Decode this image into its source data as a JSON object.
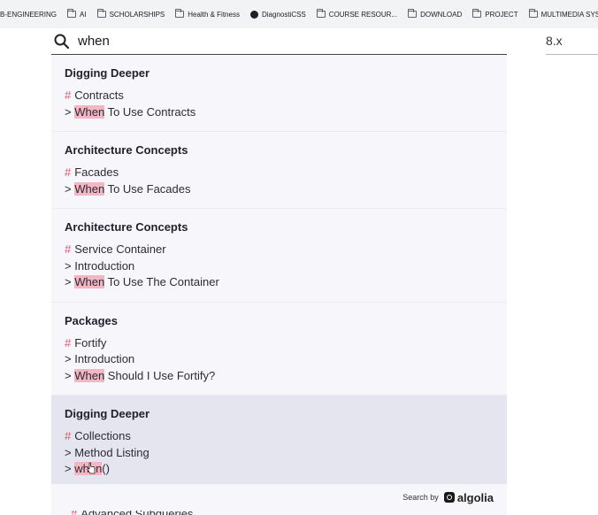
{
  "bookmarks": [
    {
      "label": "B-ENGINEERING",
      "icon": "none"
    },
    {
      "label": "AI",
      "icon": "folder-icon"
    },
    {
      "label": "SCHOLARSHIPS",
      "icon": "folder-icon"
    },
    {
      "label": "Health & Fitness",
      "icon": "folder-icon"
    },
    {
      "label": "DiagnostiCSS",
      "icon": "globe-icon"
    },
    {
      "label": "COURSE RESOUR...",
      "icon": "folder-icon"
    },
    {
      "label": "DOWNLOAD",
      "icon": "folder-icon"
    },
    {
      "label": "PROJECT",
      "icon": "folder-icon"
    },
    {
      "label": "MULTIMEDIA SYS...",
      "icon": "folder-icon"
    }
  ],
  "search": {
    "value": "when",
    "version": "8.x"
  },
  "results": [
    {
      "title": "Digging Deeper",
      "lines": [
        {
          "type": "hash",
          "pre": "",
          "hl": "",
          "post": "Contracts"
        },
        {
          "type": "arrow",
          "pre": "",
          "hl": "When",
          "post": " To Use Contracts"
        }
      ]
    },
    {
      "title": "Architecture Concepts",
      "lines": [
        {
          "type": "hash",
          "pre": "",
          "hl": "",
          "post": "Facades"
        },
        {
          "type": "arrow",
          "pre": "",
          "hl": "When",
          "post": " To Use Facades"
        }
      ]
    },
    {
      "title": "Architecture Concepts",
      "lines": [
        {
          "type": "hash",
          "pre": "",
          "hl": "",
          "post": "Service Container"
        },
        {
          "type": "arrow",
          "pre": "",
          "hl": "",
          "post": "Introduction"
        },
        {
          "type": "arrow",
          "pre": "",
          "hl": "When",
          "post": " To Use The Container"
        }
      ]
    },
    {
      "title": "Packages",
      "lines": [
        {
          "type": "hash",
          "pre": "",
          "hl": "",
          "post": "Fortify"
        },
        {
          "type": "arrow",
          "pre": "",
          "hl": "",
          "post": "Introduction"
        },
        {
          "type": "arrow",
          "pre": "",
          "hl": "When",
          "post": " Should I Use Fortify?"
        }
      ]
    },
    {
      "title": "Digging Deeper",
      "active": true,
      "lines": [
        {
          "type": "hash",
          "pre": "",
          "hl": "",
          "post": "Collections"
        },
        {
          "type": "arrow",
          "pre": "",
          "hl": "",
          "post": "Method Listing"
        },
        {
          "type": "arrow",
          "pre": "",
          "hl": "when",
          "post": "()"
        }
      ]
    }
  ],
  "footer": {
    "label": "Search by",
    "brand": "algolia"
  },
  "peek": {
    "text": "Advanced Subqueries"
  },
  "colors": {
    "highlight": "#f4b6c2",
    "hash": "#e8506a",
    "active_bg": "#e5e5ef"
  }
}
